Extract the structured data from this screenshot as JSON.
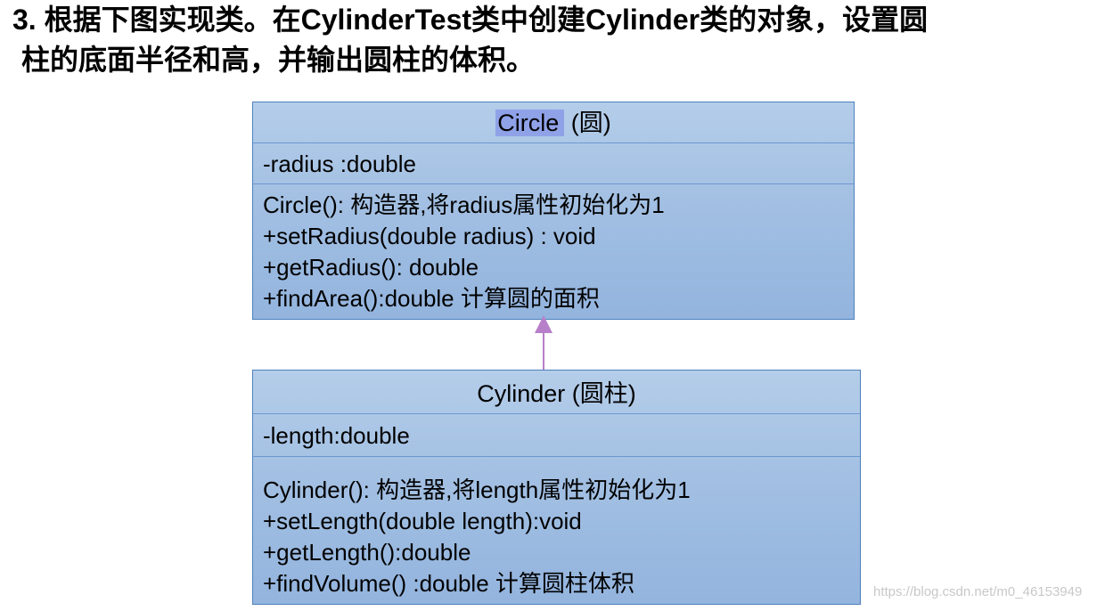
{
  "question": {
    "line1": "3. 根据下图实现类。在CylinderTest类中创建Cylinder类的对象，设置圆",
    "line2": "柱的底面半径和高，并输出圆柱的体积。"
  },
  "circle": {
    "name": "Circle",
    "cn": "(圆)",
    "attributes": [
      "-radius :double"
    ],
    "operations": [
      "Circle(): 构造器,将radius属性初始化为1",
      "+setRadius(double radius) : void",
      "+getRadius(): double",
      "+findArea():double  计算圆的面积"
    ]
  },
  "cylinder": {
    "name": "Cylinder",
    "cn": "(圆柱)",
    "attributes": [
      "-length:double"
    ],
    "operations": [
      "Cylinder():  构造器,将length属性初始化为1",
      "+setLength(double length):void",
      "+getLength():double",
      "+findVolume() :double   计算圆柱体积"
    ]
  },
  "colors": {
    "box_fill": "#a3c0e3",
    "box_border": "#4f81bd",
    "arrow": "#b77fc9",
    "highlight": "#8fa2e8"
  },
  "watermark": "https://blog.csdn.net/m0_46153949"
}
